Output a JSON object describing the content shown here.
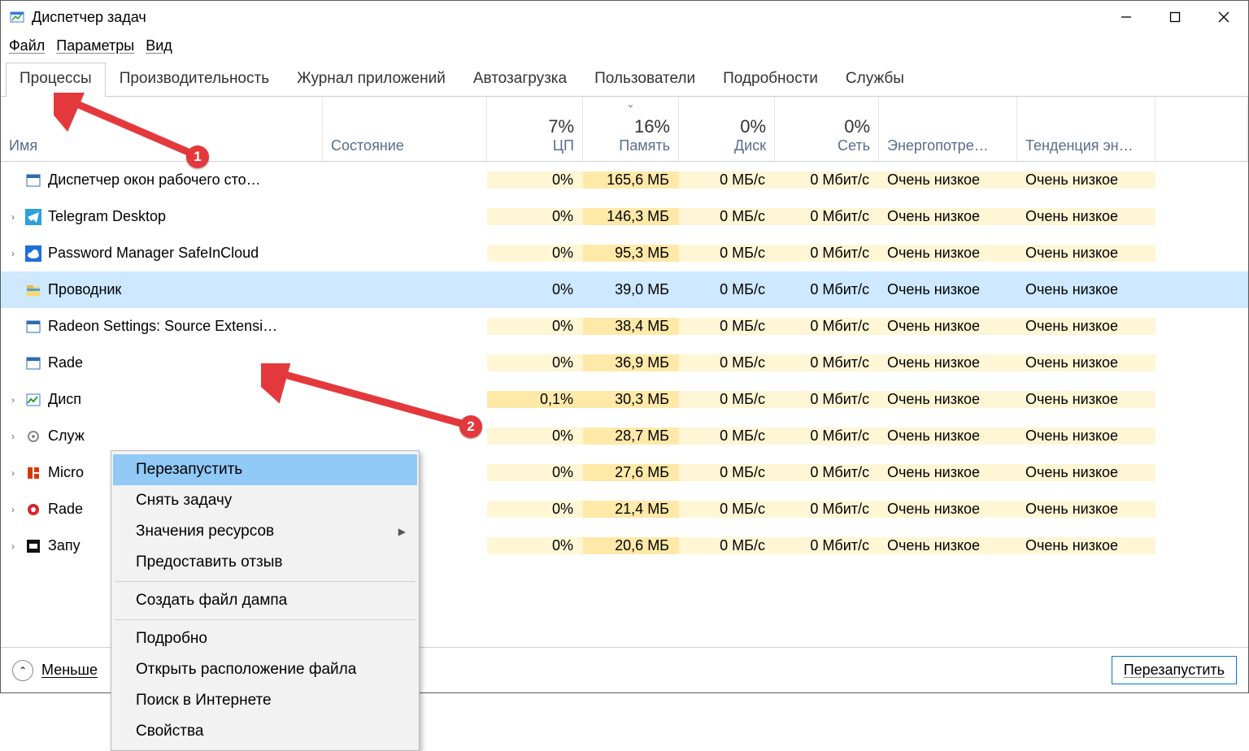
{
  "window": {
    "title": "Диспетчер задач"
  },
  "menu": {
    "file": "Файл",
    "options": "Параметры",
    "view": "Вид"
  },
  "tabs": [
    "Процессы",
    "Производительность",
    "Журнал приложений",
    "Автозагрузка",
    "Пользователи",
    "Подробности",
    "Службы"
  ],
  "headers": {
    "name": "Имя",
    "status": "Состояние",
    "cpu_pct": "7%",
    "cpu": "ЦП",
    "mem_pct": "16%",
    "mem": "Память",
    "disk_pct": "0%",
    "disk": "Диск",
    "net_pct": "0%",
    "net": "Сеть",
    "energy": "Энергопотре…",
    "energy_trend": "Тенденция эн…"
  },
  "rows": [
    {
      "expand": "",
      "icon": "window-blue",
      "name": "Диспетчер окон рабочего сто…",
      "cpu": "0%",
      "mem": "165,6 МБ",
      "disk": "0 МБ/с",
      "net": "0 Мбит/с",
      "energy": "Очень низкое",
      "trend": "Очень низкое"
    },
    {
      "expand": "›",
      "icon": "telegram",
      "name": "Telegram Desktop",
      "cpu": "0%",
      "mem": "146,3 МБ",
      "disk": "0 МБ/с",
      "net": "0 Мбит/с",
      "energy": "Очень низкое",
      "trend": "Очень низкое"
    },
    {
      "expand": "›",
      "icon": "cloud",
      "name": "Password Manager SafeInCloud",
      "cpu": "0%",
      "mem": "95,3 МБ",
      "disk": "0 МБ/с",
      "net": "0 Мбит/с",
      "energy": "Очень низкое",
      "trend": "Очень низкое"
    },
    {
      "expand": "",
      "icon": "explorer",
      "name": "Проводник",
      "selected": true,
      "cpu": "0%",
      "mem": "39,0 МБ",
      "disk": "0 МБ/с",
      "net": "0 Мбит/с",
      "energy": "Очень низкое",
      "trend": "Очень низкое"
    },
    {
      "expand": "",
      "icon": "window-blue",
      "name": "Radeon Settings: Source Extensi…",
      "cpu": "0%",
      "mem": "38,4 МБ",
      "disk": "0 МБ/с",
      "net": "0 Мбит/с",
      "energy": "Очень низкое",
      "trend": "Очень низкое"
    },
    {
      "expand": "",
      "icon": "window-blue",
      "name": "Rade",
      "cpu": "0%",
      "mem": "36,9 МБ",
      "disk": "0 МБ/с",
      "net": "0 Мбит/с",
      "energy": "Очень низкое",
      "trend": "Очень низкое"
    },
    {
      "expand": "›",
      "icon": "taskmgr",
      "name": "Дисп",
      "cpu": "0,1%",
      "cpu_high": true,
      "mem": "30,3 МБ",
      "disk": "0 МБ/с",
      "net": "0 Мбит/с",
      "energy": "Очень низкое",
      "trend": "Очень низкое"
    },
    {
      "expand": "›",
      "icon": "gear",
      "name": "Служ",
      "cpu": "0%",
      "mem": "28,7 МБ",
      "disk": "0 МБ/с",
      "net": "0 Мбит/с",
      "energy": "Очень низкое",
      "trend": "Очень низкое"
    },
    {
      "expand": "›",
      "icon": "office",
      "name": "Micro",
      "cpu": "0%",
      "mem": "27,6 МБ",
      "disk": "0 МБ/с",
      "net": "0 Мбит/с",
      "energy": "Очень низкое",
      "trend": "Очень низкое"
    },
    {
      "expand": "›",
      "icon": "radeon-red",
      "name": "Rade",
      "cpu": "0%",
      "mem": "21,4 МБ",
      "disk": "0 МБ/с",
      "net": "0 Мбит/с",
      "energy": "Очень низкое",
      "trend": "Очень низкое"
    },
    {
      "expand": "›",
      "icon": "black-sq",
      "name": "Запу",
      "cpu": "0%",
      "mem": "20,6 МБ",
      "disk": "0 МБ/с",
      "net": "0 Мбит/с",
      "energy": "Очень низкое",
      "trend": "Очень низкое"
    }
  ],
  "context_menu": {
    "items": [
      {
        "label": "Перезапустить",
        "highlight": true
      },
      {
        "label": "Снять задачу"
      },
      {
        "label": "Значения ресурсов",
        "submenu": true
      },
      {
        "label": "Предоставить отзыв"
      },
      {
        "sep": true
      },
      {
        "label": "Создать файл дампа"
      },
      {
        "sep": true
      },
      {
        "label": "Подробно"
      },
      {
        "label": "Открыть расположение файла"
      },
      {
        "label": "Поиск в Интернете"
      },
      {
        "label": "Свойства"
      }
    ]
  },
  "bottom": {
    "fewer": "Меньше",
    "restart": "Перезапустить"
  },
  "annotations": {
    "badge1": "1",
    "badge2": "2"
  }
}
